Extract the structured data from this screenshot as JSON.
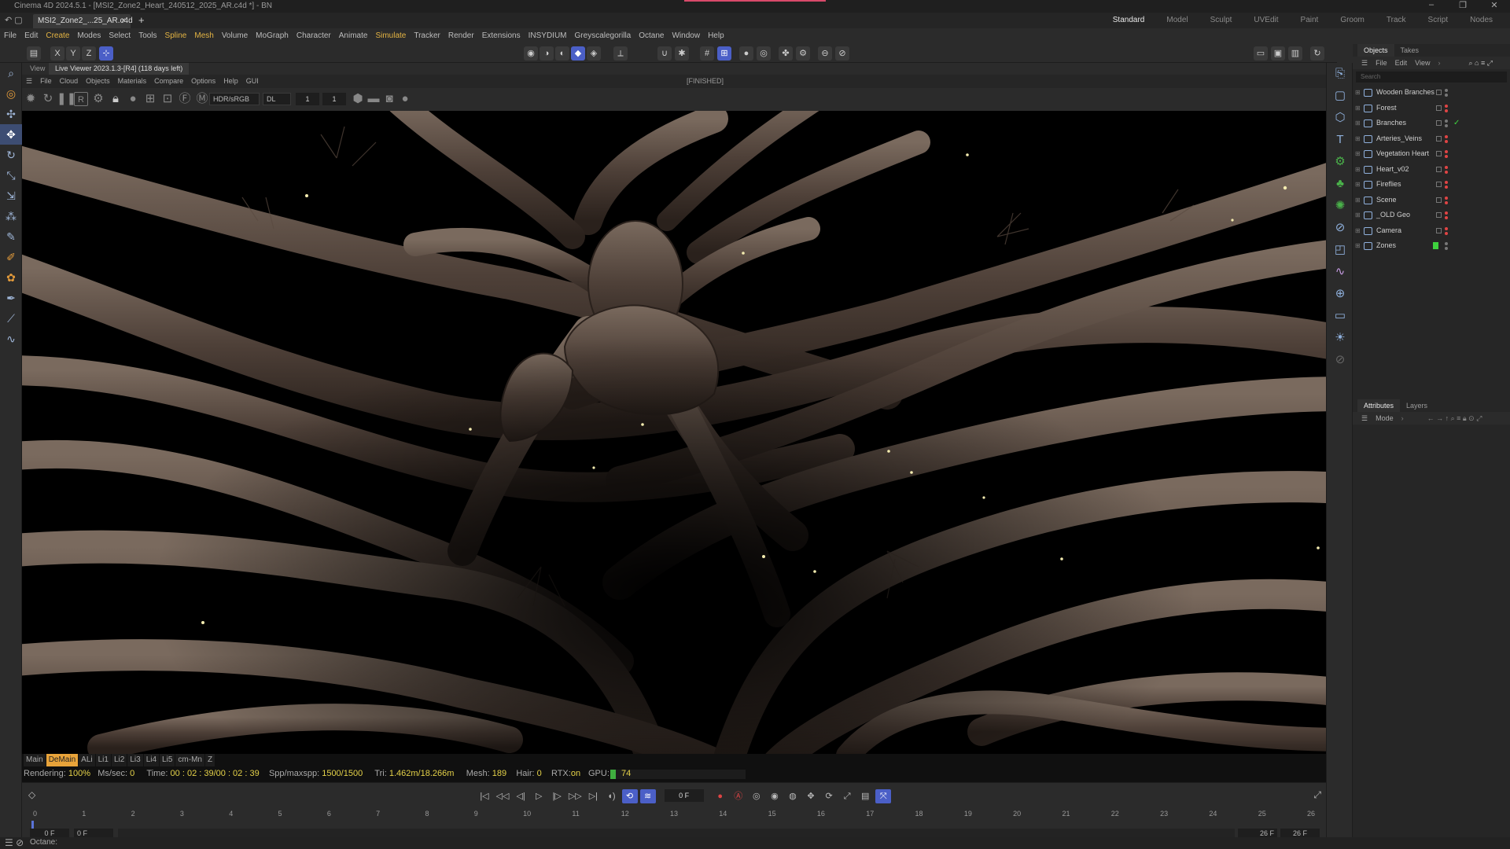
{
  "window": {
    "title": "Cinema 4D 2024.5.1 - [MSI2_Zone2_Heart_240512_2025_AR.c4d *] - BN"
  },
  "document_tab": {
    "label": "MSI2_Zone2_...25_AR.c4d *",
    "close": "×",
    "new": "+"
  },
  "layouts": [
    "Standard",
    "Model",
    "Sculpt",
    "UVEdit",
    "Paint",
    "Groom",
    "Track",
    "Script",
    "Nodes"
  ],
  "menu": [
    "File",
    "Edit",
    "Create",
    "Modes",
    "Select",
    "Tools",
    "Spline",
    "Mesh",
    "Volume",
    "MoGraph",
    "Character",
    "Animate",
    "Simulate",
    "Tracker",
    "Render",
    "Extensions",
    "INSYDIUM",
    "Greyscalegorilla",
    "Octane",
    "Window",
    "Help"
  ],
  "axes": {
    "x": "X",
    "y": "Y",
    "z": "Z"
  },
  "viewport": {
    "view_label": "View",
    "tab": "Live Viewer 2023.1.3-[R4] (118 days left)",
    "status": "[FINISHED]"
  },
  "lv_menu": [
    "File",
    "Cloud",
    "Objects",
    "Materials",
    "Compare",
    "Options",
    "Help",
    "GUI"
  ],
  "lv_toolbar": {
    "r_label": "R",
    "color_space": "HDR/sRGB",
    "kernel": "DL",
    "val1": "1",
    "val2": "1"
  },
  "layer_tabs": [
    "Main",
    "DeMain",
    "ALi",
    "Li1",
    "Li2",
    "Li3",
    "Li4",
    "Li5",
    "cm-Mn",
    "Z"
  ],
  "stats": {
    "rendering_label": "Rendering:",
    "rendering": "100%",
    "ms_label": "Ms/sec:",
    "ms": "0",
    "time_label": "Time:",
    "time": "00 : 02 : 39/00 : 02 : 39",
    "spp_label": "Spp/maxspp:",
    "spp": "1500/1500",
    "tri_label": "Tri:",
    "tri": "1.462m/18.266m",
    "mesh_label": "Mesh:",
    "mesh": "189",
    "hair_label": "Hair:",
    "hair": "0",
    "rtx_label": "RTX:",
    "rtx": "on",
    "gpu_label": "GPU:",
    "gpu": "74",
    "gpu_fill": 0.04
  },
  "timeline": {
    "frame": "0 F",
    "ticks": [
      "0",
      "1",
      "2",
      "3",
      "4",
      "5",
      "6",
      "7",
      "8",
      "9",
      "10",
      "11",
      "12",
      "13",
      "14",
      "15",
      "16",
      "17",
      "18",
      "19",
      "20",
      "21",
      "22",
      "23",
      "24",
      "25",
      "26"
    ],
    "range_start": "0 F",
    "range_start2": "0 F",
    "range_end": "26 F",
    "range_end2": "26 F"
  },
  "bottom": {
    "status": "Octane:"
  },
  "objects_panel": {
    "tabs": [
      "Objects",
      "Takes"
    ],
    "menu": [
      "File",
      "Edit",
      "View"
    ],
    "search_placeholder": "Search",
    "items": [
      {
        "name": "Wooden Branches",
        "dots": "grey"
      },
      {
        "name": "Forest",
        "dots": "red"
      },
      {
        "name": "Branches",
        "dots": "grey",
        "check": "✓"
      },
      {
        "name": "Arteries_Veins",
        "dots": "red"
      },
      {
        "name": "Vegetation Heart",
        "dots": "red"
      },
      {
        "name": "Heart_v02",
        "dots": "red"
      },
      {
        "name": "Fireflies",
        "dots": "red"
      },
      {
        "name": "Scene",
        "dots": "red"
      },
      {
        "name": "_OLD Geo",
        "dots": "red"
      },
      {
        "name": "Camera",
        "dots": "red"
      },
      {
        "name": "Zones",
        "dots": "grey",
        "tag": "green"
      }
    ]
  },
  "attributes_panel": {
    "tabs": [
      "Attributes",
      "Layers"
    ],
    "mode": "Mode"
  },
  "colors": {
    "accent": "#4b5fc7",
    "highlight": "#e4b443",
    "green": "#3ed13e",
    "red": "#e04444"
  }
}
